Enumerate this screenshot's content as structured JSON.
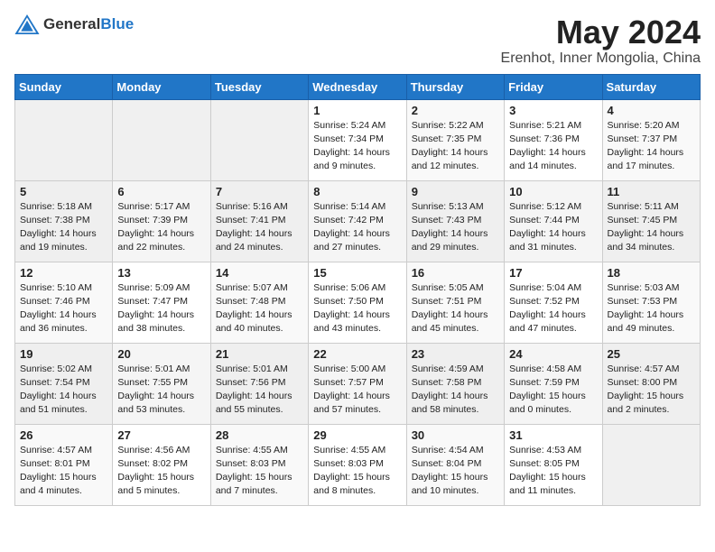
{
  "header": {
    "logo_general": "General",
    "logo_blue": "Blue",
    "month_year": "May 2024",
    "location": "Erenhot, Inner Mongolia, China"
  },
  "weekdays": [
    "Sunday",
    "Monday",
    "Tuesday",
    "Wednesday",
    "Thursday",
    "Friday",
    "Saturday"
  ],
  "weeks": [
    [
      {
        "day": "",
        "lines": []
      },
      {
        "day": "",
        "lines": []
      },
      {
        "day": "",
        "lines": []
      },
      {
        "day": "1",
        "lines": [
          "Sunrise: 5:24 AM",
          "Sunset: 7:34 PM",
          "Daylight: 14 hours",
          "and 9 minutes."
        ]
      },
      {
        "day": "2",
        "lines": [
          "Sunrise: 5:22 AM",
          "Sunset: 7:35 PM",
          "Daylight: 14 hours",
          "and 12 minutes."
        ]
      },
      {
        "day": "3",
        "lines": [
          "Sunrise: 5:21 AM",
          "Sunset: 7:36 PM",
          "Daylight: 14 hours",
          "and 14 minutes."
        ]
      },
      {
        "day": "4",
        "lines": [
          "Sunrise: 5:20 AM",
          "Sunset: 7:37 PM",
          "Daylight: 14 hours",
          "and 17 minutes."
        ]
      }
    ],
    [
      {
        "day": "5",
        "lines": [
          "Sunrise: 5:18 AM",
          "Sunset: 7:38 PM",
          "Daylight: 14 hours",
          "and 19 minutes."
        ]
      },
      {
        "day": "6",
        "lines": [
          "Sunrise: 5:17 AM",
          "Sunset: 7:39 PM",
          "Daylight: 14 hours",
          "and 22 minutes."
        ]
      },
      {
        "day": "7",
        "lines": [
          "Sunrise: 5:16 AM",
          "Sunset: 7:41 PM",
          "Daylight: 14 hours",
          "and 24 minutes."
        ]
      },
      {
        "day": "8",
        "lines": [
          "Sunrise: 5:14 AM",
          "Sunset: 7:42 PM",
          "Daylight: 14 hours",
          "and 27 minutes."
        ]
      },
      {
        "day": "9",
        "lines": [
          "Sunrise: 5:13 AM",
          "Sunset: 7:43 PM",
          "Daylight: 14 hours",
          "and 29 minutes."
        ]
      },
      {
        "day": "10",
        "lines": [
          "Sunrise: 5:12 AM",
          "Sunset: 7:44 PM",
          "Daylight: 14 hours",
          "and 31 minutes."
        ]
      },
      {
        "day": "11",
        "lines": [
          "Sunrise: 5:11 AM",
          "Sunset: 7:45 PM",
          "Daylight: 14 hours",
          "and 34 minutes."
        ]
      }
    ],
    [
      {
        "day": "12",
        "lines": [
          "Sunrise: 5:10 AM",
          "Sunset: 7:46 PM",
          "Daylight: 14 hours",
          "and 36 minutes."
        ]
      },
      {
        "day": "13",
        "lines": [
          "Sunrise: 5:09 AM",
          "Sunset: 7:47 PM",
          "Daylight: 14 hours",
          "and 38 minutes."
        ]
      },
      {
        "day": "14",
        "lines": [
          "Sunrise: 5:07 AM",
          "Sunset: 7:48 PM",
          "Daylight: 14 hours",
          "and 40 minutes."
        ]
      },
      {
        "day": "15",
        "lines": [
          "Sunrise: 5:06 AM",
          "Sunset: 7:50 PM",
          "Daylight: 14 hours",
          "and 43 minutes."
        ]
      },
      {
        "day": "16",
        "lines": [
          "Sunrise: 5:05 AM",
          "Sunset: 7:51 PM",
          "Daylight: 14 hours",
          "and 45 minutes."
        ]
      },
      {
        "day": "17",
        "lines": [
          "Sunrise: 5:04 AM",
          "Sunset: 7:52 PM",
          "Daylight: 14 hours",
          "and 47 minutes."
        ]
      },
      {
        "day": "18",
        "lines": [
          "Sunrise: 5:03 AM",
          "Sunset: 7:53 PM",
          "Daylight: 14 hours",
          "and 49 minutes."
        ]
      }
    ],
    [
      {
        "day": "19",
        "lines": [
          "Sunrise: 5:02 AM",
          "Sunset: 7:54 PM",
          "Daylight: 14 hours",
          "and 51 minutes."
        ]
      },
      {
        "day": "20",
        "lines": [
          "Sunrise: 5:01 AM",
          "Sunset: 7:55 PM",
          "Daylight: 14 hours",
          "and 53 minutes."
        ]
      },
      {
        "day": "21",
        "lines": [
          "Sunrise: 5:01 AM",
          "Sunset: 7:56 PM",
          "Daylight: 14 hours",
          "and 55 minutes."
        ]
      },
      {
        "day": "22",
        "lines": [
          "Sunrise: 5:00 AM",
          "Sunset: 7:57 PM",
          "Daylight: 14 hours",
          "and 57 minutes."
        ]
      },
      {
        "day": "23",
        "lines": [
          "Sunrise: 4:59 AM",
          "Sunset: 7:58 PM",
          "Daylight: 14 hours",
          "and 58 minutes."
        ]
      },
      {
        "day": "24",
        "lines": [
          "Sunrise: 4:58 AM",
          "Sunset: 7:59 PM",
          "Daylight: 15 hours",
          "and 0 minutes."
        ]
      },
      {
        "day": "25",
        "lines": [
          "Sunrise: 4:57 AM",
          "Sunset: 8:00 PM",
          "Daylight: 15 hours",
          "and 2 minutes."
        ]
      }
    ],
    [
      {
        "day": "26",
        "lines": [
          "Sunrise: 4:57 AM",
          "Sunset: 8:01 PM",
          "Daylight: 15 hours",
          "and 4 minutes."
        ]
      },
      {
        "day": "27",
        "lines": [
          "Sunrise: 4:56 AM",
          "Sunset: 8:02 PM",
          "Daylight: 15 hours",
          "and 5 minutes."
        ]
      },
      {
        "day": "28",
        "lines": [
          "Sunrise: 4:55 AM",
          "Sunset: 8:03 PM",
          "Daylight: 15 hours",
          "and 7 minutes."
        ]
      },
      {
        "day": "29",
        "lines": [
          "Sunrise: 4:55 AM",
          "Sunset: 8:03 PM",
          "Daylight: 15 hours",
          "and 8 minutes."
        ]
      },
      {
        "day": "30",
        "lines": [
          "Sunrise: 4:54 AM",
          "Sunset: 8:04 PM",
          "Daylight: 15 hours",
          "and 10 minutes."
        ]
      },
      {
        "day": "31",
        "lines": [
          "Sunrise: 4:53 AM",
          "Sunset: 8:05 PM",
          "Daylight: 15 hours",
          "and 11 minutes."
        ]
      },
      {
        "day": "",
        "lines": []
      }
    ]
  ]
}
